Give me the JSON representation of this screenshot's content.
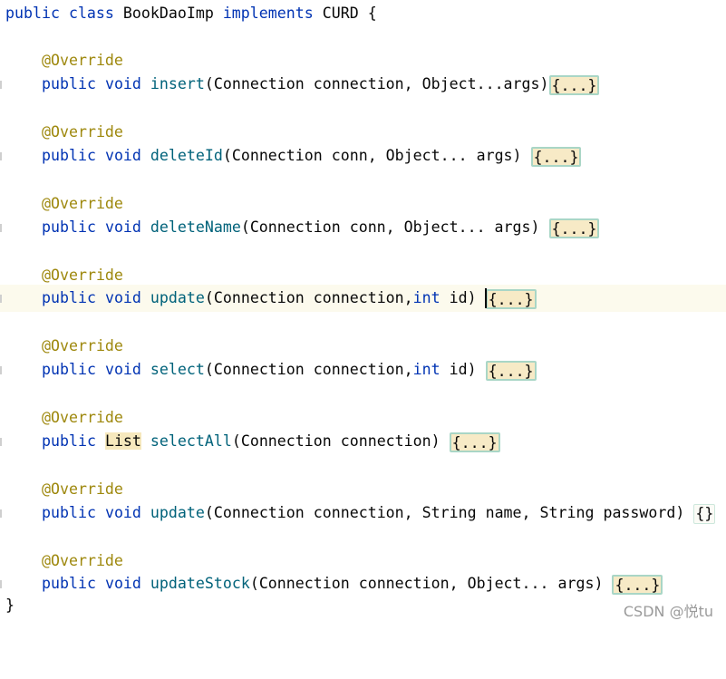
{
  "code": {
    "class_decl": {
      "kw1": "public",
      "kw2": "class",
      "name": "BookDaoImp",
      "kw3": "implements",
      "iface": "CURD",
      "brace": "{"
    },
    "override_label": "@Override",
    "methods": [
      {
        "kw_public": "public",
        "return_type": "void",
        "name": "insert",
        "params": "(Connection connection, Object...args)",
        "fold": "{...}"
      },
      {
        "kw_public": "public",
        "return_type": "void",
        "name": "deleteId",
        "params": "(Connection conn, Object... args) ",
        "fold": "{...}"
      },
      {
        "kw_public": "public",
        "return_type": "void",
        "name": "deleteName",
        "params": "(Connection conn, Object... args) ",
        "fold": "{...}"
      },
      {
        "kw_public": "public",
        "return_type": "void",
        "name": "update",
        "params_a": "(Connection connection,",
        "params_kw": "int",
        "params_b": " id) ",
        "fold": "{...}"
      },
      {
        "kw_public": "public",
        "return_type": "void",
        "name": "select",
        "params_a": "(Connection connection,",
        "params_kw": "int",
        "params_b": " id) ",
        "fold": "{...}"
      },
      {
        "kw_public": "public",
        "return_type": "List",
        "name": "selectAll",
        "params": "(Connection connection) ",
        "fold": "{...}"
      },
      {
        "kw_public": "public",
        "return_type": "void",
        "name": "update",
        "params": "(Connection connection, String name, String password) ",
        "fold": "{}"
      },
      {
        "kw_public": "public",
        "return_type": "void",
        "name": "updateStock",
        "params": "(Connection connection, Object... args) ",
        "fold": "{...}"
      }
    ],
    "closing_brace": "}"
  },
  "watermark": "CSDN @悦tu",
  "colors": {
    "keyword": "#0033b3",
    "annotation": "#9e880d",
    "method": "#00627a",
    "fold_bg": "#f7eac6",
    "fold_border": "#a9d6c6",
    "current_line": "#fcfaed"
  }
}
